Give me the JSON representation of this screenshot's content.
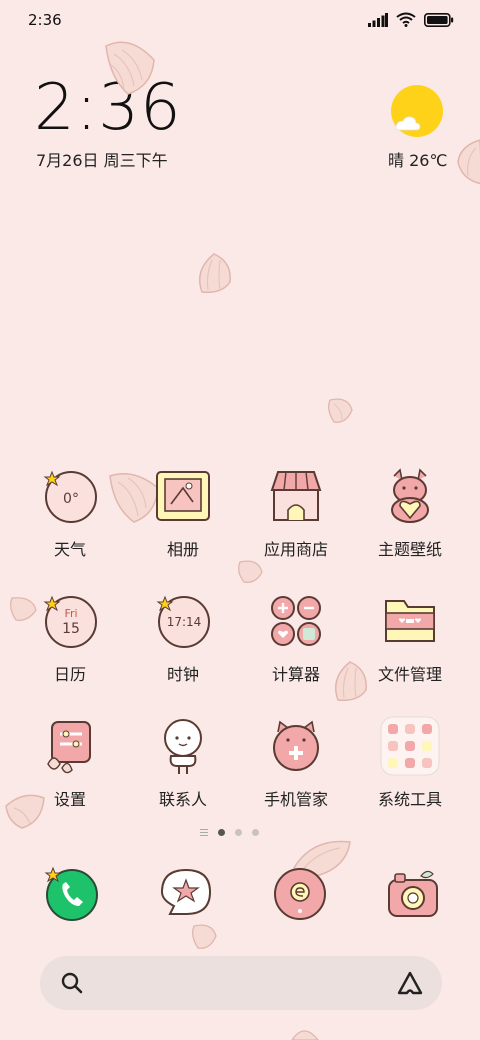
{
  "status_bar": {
    "time": "2:36"
  },
  "clock": {
    "time": "2:36",
    "date": "7月26日 周三下午"
  },
  "weather": {
    "text": "晴 26℃"
  },
  "apps": [
    {
      "label": "天气",
      "icon": "weather-icon",
      "icon_text": "0°"
    },
    {
      "label": "相册",
      "icon": "gallery-icon"
    },
    {
      "label": "应用商店",
      "icon": "app-store-icon"
    },
    {
      "label": "主题壁纸",
      "icon": "themes-icon"
    },
    {
      "label": "日历",
      "icon": "calendar-icon",
      "icon_text": "Fri",
      "icon_text2": "15"
    },
    {
      "label": "时钟",
      "icon": "clock-icon",
      "icon_text": "17:14"
    },
    {
      "label": "计算器",
      "icon": "calculator-icon"
    },
    {
      "label": "文件管理",
      "icon": "file-manager-icon"
    },
    {
      "label": "设置",
      "icon": "settings-icon"
    },
    {
      "label": "联系人",
      "icon": "contacts-icon"
    },
    {
      "label": "手机管家",
      "icon": "security-icon"
    },
    {
      "label": "系统工具",
      "icon": "system-tools-folder-icon"
    }
  ],
  "dock": [
    {
      "name": "phone",
      "icon": "phone-icon"
    },
    {
      "name": "messages",
      "icon": "messages-icon"
    },
    {
      "name": "browser",
      "icon": "browser-icon"
    },
    {
      "name": "camera",
      "icon": "camera-icon"
    }
  ],
  "page_indicator": {
    "pages": 3,
    "active": 1
  },
  "colors": {
    "background": "#fbe9e7",
    "icon_pink": "#f2a8a8",
    "phone_green": "#1ec26a"
  }
}
